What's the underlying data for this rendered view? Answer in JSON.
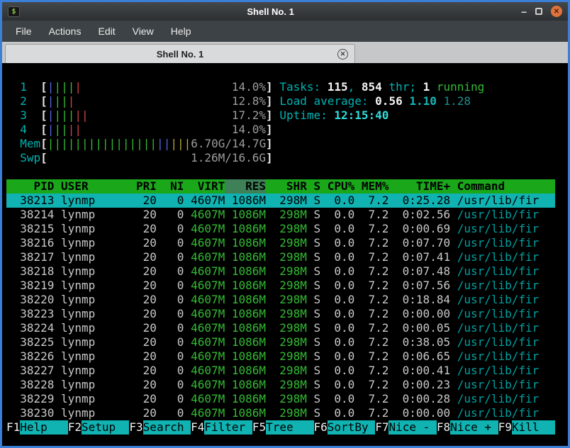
{
  "window": {
    "title": "Shell No. 1",
    "menu": [
      "File",
      "Actions",
      "Edit",
      "View",
      "Help"
    ],
    "tab_label": "Shell No. 1",
    "icons": {
      "app": "$",
      "minimize": "–",
      "close": "✕",
      "tab_close": "✕"
    },
    "colors": {
      "frame_blue": "#3b7fd6",
      "header_green": "#1aa81a",
      "sorted_column": "#3e8057",
      "selection_cyan": "#10b2b2",
      "label_cyan": "#00b2b2",
      "value_green": "#33bb33"
    }
  },
  "htop": {
    "meters": [
      {
        "label": "1",
        "ticks": [
          "b",
          "g",
          "g",
          "g",
          "r"
        ],
        "value": "14.0%"
      },
      {
        "label": "2",
        "ticks": [
          "b",
          "g",
          "g",
          "r"
        ],
        "value": "12.8%"
      },
      {
        "label": "3",
        "ticks": [
          "b",
          "g",
          "g",
          "g",
          "r",
          "r"
        ],
        "value": "17.2%"
      },
      {
        "label": "4",
        "ticks": [
          "b",
          "g",
          "g",
          "r",
          "r"
        ],
        "value": "14.0%"
      },
      {
        "label": "Mem",
        "ticks": [
          "g",
          "g",
          "g",
          "g",
          "g",
          "g",
          "g",
          "g",
          "g",
          "g",
          "g",
          "g",
          "g",
          "g",
          "g",
          "g",
          "b",
          "b",
          "y",
          "y",
          "y"
        ],
        "value": "6.70G/14.7G"
      },
      {
        "label": "Swp",
        "ticks": [],
        "value": "1.26M/16.6G"
      }
    ],
    "tasks": {
      "label": "Tasks:",
      "count": "115",
      "comma": ",",
      "threads": "854",
      "thr_label": "thr;",
      "running_count": "1",
      "running_label": "running"
    },
    "load": {
      "label": "Load average:",
      "one": "0.56",
      "five": "1.10",
      "fifteen": "1.28"
    },
    "uptime": {
      "label": "Uptime:",
      "value": "12:15:40"
    },
    "columns": [
      "PID",
      "USER",
      "PRI",
      "NI",
      "VIRT",
      "RES",
      "SHR",
      "S",
      "CPU%",
      "MEM%",
      "TIME+",
      "Command"
    ],
    "sort_column": "RES",
    "rows": [
      {
        "pid": "38213",
        "user": "lynmp",
        "pri": "20",
        "ni": "0",
        "virt": "4607M",
        "res": "1086M",
        "shr": "298M",
        "s": "S",
        "cpu": "0.0",
        "mem": "7.2",
        "time": "0:25.28",
        "cmd": "/usr/lib/fir",
        "selected": true
      },
      {
        "pid": "38214",
        "user": "lynmp",
        "pri": "20",
        "ni": "0",
        "virt": "4607M",
        "res": "1086M",
        "shr": "298M",
        "s": "S",
        "cpu": "0.0",
        "mem": "7.2",
        "time": "0:02.56",
        "cmd": "/usr/lib/fir",
        "selected": false
      },
      {
        "pid": "38215",
        "user": "lynmp",
        "pri": "20",
        "ni": "0",
        "virt": "4607M",
        "res": "1086M",
        "shr": "298M",
        "s": "S",
        "cpu": "0.0",
        "mem": "7.2",
        "time": "0:00.69",
        "cmd": "/usr/lib/fir",
        "selected": false
      },
      {
        "pid": "38216",
        "user": "lynmp",
        "pri": "20",
        "ni": "0",
        "virt": "4607M",
        "res": "1086M",
        "shr": "298M",
        "s": "S",
        "cpu": "0.0",
        "mem": "7.2",
        "time": "0:07.70",
        "cmd": "/usr/lib/fir",
        "selected": false
      },
      {
        "pid": "38217",
        "user": "lynmp",
        "pri": "20",
        "ni": "0",
        "virt": "4607M",
        "res": "1086M",
        "shr": "298M",
        "s": "S",
        "cpu": "0.0",
        "mem": "7.2",
        "time": "0:07.41",
        "cmd": "/usr/lib/fir",
        "selected": false
      },
      {
        "pid": "38218",
        "user": "lynmp",
        "pri": "20",
        "ni": "0",
        "virt": "4607M",
        "res": "1086M",
        "shr": "298M",
        "s": "S",
        "cpu": "0.0",
        "mem": "7.2",
        "time": "0:07.48",
        "cmd": "/usr/lib/fir",
        "selected": false
      },
      {
        "pid": "38219",
        "user": "lynmp",
        "pri": "20",
        "ni": "0",
        "virt": "4607M",
        "res": "1086M",
        "shr": "298M",
        "s": "S",
        "cpu": "0.0",
        "mem": "7.2",
        "time": "0:07.56",
        "cmd": "/usr/lib/fir",
        "selected": false
      },
      {
        "pid": "38220",
        "user": "lynmp",
        "pri": "20",
        "ni": "0",
        "virt": "4607M",
        "res": "1086M",
        "shr": "298M",
        "s": "S",
        "cpu": "0.0",
        "mem": "7.2",
        "time": "0:18.84",
        "cmd": "/usr/lib/fir",
        "selected": false
      },
      {
        "pid": "38223",
        "user": "lynmp",
        "pri": "20",
        "ni": "0",
        "virt": "4607M",
        "res": "1086M",
        "shr": "298M",
        "s": "S",
        "cpu": "0.0",
        "mem": "7.2",
        "time": "0:00.00",
        "cmd": "/usr/lib/fir",
        "selected": false
      },
      {
        "pid": "38224",
        "user": "lynmp",
        "pri": "20",
        "ni": "0",
        "virt": "4607M",
        "res": "1086M",
        "shr": "298M",
        "s": "S",
        "cpu": "0.0",
        "mem": "7.2",
        "time": "0:00.05",
        "cmd": "/usr/lib/fir",
        "selected": false
      },
      {
        "pid": "38225",
        "user": "lynmp",
        "pri": "20",
        "ni": "0",
        "virt": "4607M",
        "res": "1086M",
        "shr": "298M",
        "s": "S",
        "cpu": "0.0",
        "mem": "7.2",
        "time": "0:38.05",
        "cmd": "/usr/lib/fir",
        "selected": false
      },
      {
        "pid": "38226",
        "user": "lynmp",
        "pri": "20",
        "ni": "0",
        "virt": "4607M",
        "res": "1086M",
        "shr": "298M",
        "s": "S",
        "cpu": "0.0",
        "mem": "7.2",
        "time": "0:06.65",
        "cmd": "/usr/lib/fir",
        "selected": false
      },
      {
        "pid": "38227",
        "user": "lynmp",
        "pri": "20",
        "ni": "0",
        "virt": "4607M",
        "res": "1086M",
        "shr": "298M",
        "s": "S",
        "cpu": "0.0",
        "mem": "7.2",
        "time": "0:00.41",
        "cmd": "/usr/lib/fir",
        "selected": false
      },
      {
        "pid": "38228",
        "user": "lynmp",
        "pri": "20",
        "ni": "0",
        "virt": "4607M",
        "res": "1086M",
        "shr": "298M",
        "s": "S",
        "cpu": "0.0",
        "mem": "7.2",
        "time": "0:00.23",
        "cmd": "/usr/lib/fir",
        "selected": false
      },
      {
        "pid": "38229",
        "user": "lynmp",
        "pri": "20",
        "ni": "0",
        "virt": "4607M",
        "res": "1086M",
        "shr": "298M",
        "s": "S",
        "cpu": "0.0",
        "mem": "7.2",
        "time": "0:00.28",
        "cmd": "/usr/lib/fir",
        "selected": false
      },
      {
        "pid": "38230",
        "user": "lynmp",
        "pri": "20",
        "ni": "0",
        "virt": "4607M",
        "res": "1086M",
        "shr": "298M",
        "s": "S",
        "cpu": "0.0",
        "mem": "7.2",
        "time": "0:00.00",
        "cmd": "/usr/lib/fir",
        "selected": false
      }
    ],
    "fkeys": [
      {
        "key": "F1",
        "label": "Help"
      },
      {
        "key": "F2",
        "label": "Setup"
      },
      {
        "key": "F3",
        "label": "Search"
      },
      {
        "key": "F4",
        "label": "Filter"
      },
      {
        "key": "F5",
        "label": "Tree"
      },
      {
        "key": "F6",
        "label": "SortBy"
      },
      {
        "key": "F7",
        "label": "Nice -"
      },
      {
        "key": "F8",
        "label": "Nice +"
      },
      {
        "key": "F9",
        "label": "Kill"
      }
    ]
  }
}
